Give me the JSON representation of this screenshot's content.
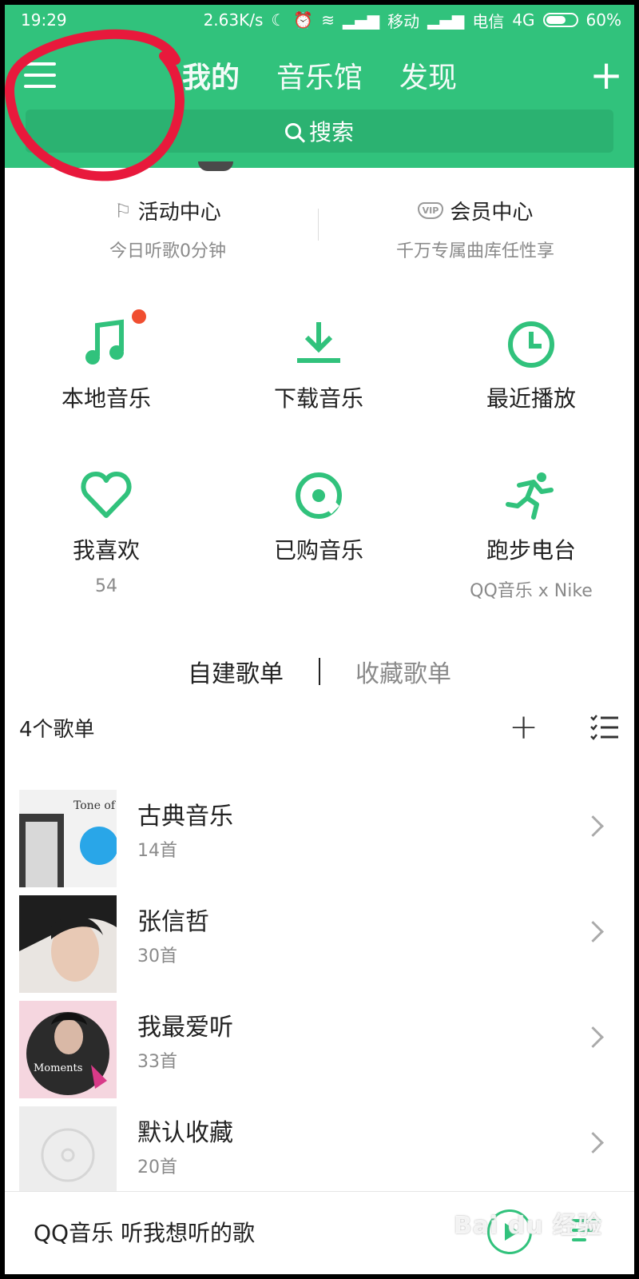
{
  "status_bar": {
    "time": "19:29",
    "speed": "2.63K/s",
    "carrier1": "移动",
    "carrier2": "电信",
    "network": "4G",
    "battery": "60%"
  },
  "header": {
    "tabs": [
      "我的",
      "音乐馆",
      "发现"
    ],
    "active_tab": "我的",
    "search_label": "搜索",
    "accent_color": "#31c27c"
  },
  "activity": {
    "left": {
      "title": "活动中心",
      "subtitle": "今日听歌0分钟"
    },
    "right": {
      "title": "会员中心",
      "subtitle": "千万专属曲库任性享",
      "badge": "VIP"
    }
  },
  "grid": [
    {
      "label": "本地音乐",
      "icon": "music-note-icon"
    },
    {
      "label": "下载音乐",
      "icon": "download-icon"
    },
    {
      "label": "最近播放",
      "icon": "clock-icon"
    },
    {
      "label": "我喜欢",
      "sub": "54",
      "icon": "heart-icon"
    },
    {
      "label": "已购音乐",
      "icon": "disc-icon"
    },
    {
      "label": "跑步电台",
      "sub": "QQ音乐 x Nike",
      "icon": "running-icon"
    }
  ],
  "playlists": {
    "tab_active": "自建歌单",
    "tab_inactive": "收藏歌单",
    "count_label": "4个歌单",
    "items": [
      {
        "name": "古典音乐",
        "count": "14首",
        "cover_text": "Tone of voice"
      },
      {
        "name": "张信哲",
        "count": "30首"
      },
      {
        "name": "我最爱听",
        "count": "33首",
        "cover_text": "Moments"
      },
      {
        "name": "默认收藏",
        "count": "20首"
      }
    ]
  },
  "player": {
    "title": "QQ音乐 听我想听的歌"
  },
  "watermark": "Bai du 经验"
}
